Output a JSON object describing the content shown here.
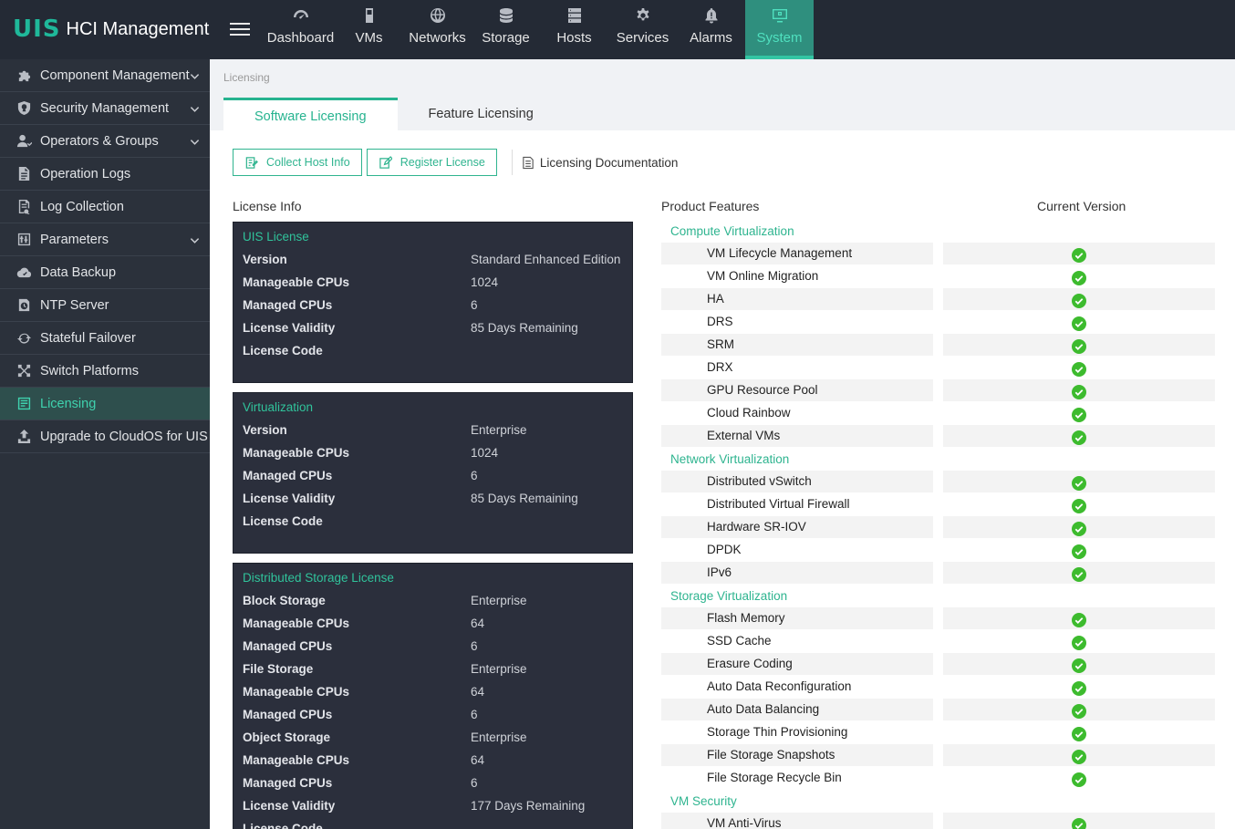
{
  "app": {
    "logo_mark": "UIS",
    "logo_text": "HCI Management"
  },
  "nav": [
    {
      "label": "Dashboard",
      "icon": "gauge-icon"
    },
    {
      "label": "VMs",
      "icon": "vm-icon"
    },
    {
      "label": "Networks",
      "icon": "globe-icon"
    },
    {
      "label": "Storage",
      "icon": "database-icon"
    },
    {
      "label": "Hosts",
      "icon": "server-icon"
    },
    {
      "label": "Services",
      "icon": "gear-icon"
    },
    {
      "label": "Alarms",
      "icon": "bell-icon"
    },
    {
      "label": "System",
      "icon": "monitor-icon",
      "active": true
    }
  ],
  "sidebar": [
    {
      "label": "Component Management",
      "icon": "puzzle-icon",
      "expandable": true
    },
    {
      "label": "Security Management",
      "icon": "shield-icon",
      "expandable": true
    },
    {
      "label": "Operators & Groups",
      "icon": "user-icon",
      "expandable": true
    },
    {
      "label": "Operation Logs",
      "icon": "file-icon"
    },
    {
      "label": "Log Collection",
      "icon": "log-icon"
    },
    {
      "label": "Parameters",
      "icon": "sliders-icon",
      "expandable": true
    },
    {
      "label": "Data Backup",
      "icon": "cloud-icon"
    },
    {
      "label": "NTP Server",
      "icon": "clock-icon"
    },
    {
      "label": "Stateful Failover",
      "icon": "failover-icon"
    },
    {
      "label": "Switch Platforms",
      "icon": "switch-icon"
    },
    {
      "label": "Licensing",
      "icon": "license-icon",
      "active": true
    },
    {
      "label": "Upgrade to CloudOS for UIS",
      "icon": "upgrade-icon"
    }
  ],
  "breadcrumb": "Licensing",
  "tabs": [
    {
      "label": "Software Licensing",
      "active": true
    },
    {
      "label": "Feature Licensing"
    }
  ],
  "toolbar": {
    "collect": "Collect Host Info",
    "register": "Register License",
    "doc": "Licensing Documentation"
  },
  "license_info_title": "License Info",
  "license_cards": [
    {
      "title": "UIS License",
      "rows": [
        {
          "k": "Version",
          "v": "Standard Enhanced Edition"
        },
        {
          "k": "Manageable CPUs",
          "v": "1024"
        },
        {
          "k": "Managed CPUs",
          "v": "6"
        },
        {
          "k": "License Validity",
          "v": "85 Days Remaining"
        },
        {
          "k": "License Code",
          "v": ""
        }
      ]
    },
    {
      "title": "Virtualization",
      "rows": [
        {
          "k": "Version",
          "v": "Enterprise"
        },
        {
          "k": "Manageable CPUs",
          "v": "1024"
        },
        {
          "k": "Managed CPUs",
          "v": "6"
        },
        {
          "k": "License Validity",
          "v": "85 Days Remaining"
        },
        {
          "k": "License Code",
          "v": ""
        }
      ]
    },
    {
      "title": "Distributed Storage License",
      "rows": [
        {
          "k": "Block Storage",
          "v": "Enterprise"
        },
        {
          "k": "Manageable CPUs",
          "v": "64"
        },
        {
          "k": "Managed CPUs",
          "v": "6"
        },
        {
          "k": "File Storage",
          "v": "Enterprise"
        },
        {
          "k": "Manageable CPUs",
          "v": "64"
        },
        {
          "k": "Managed CPUs",
          "v": "6"
        },
        {
          "k": "Object Storage",
          "v": "Enterprise"
        },
        {
          "k": "Manageable CPUs",
          "v": "64"
        },
        {
          "k": "Managed CPUs",
          "v": "6"
        },
        {
          "k": "License Validity",
          "v": "177 Days Remaining"
        },
        {
          "k": "License Code",
          "v": ""
        }
      ]
    }
  ],
  "features_header": {
    "product": "Product Features",
    "version": "Current Version"
  },
  "feature_groups": [
    {
      "title": "Compute Virtualization",
      "items": [
        "VM Lifecycle Management",
        "VM Online Migration",
        "HA",
        "DRS",
        "SRM",
        "DRX",
        "GPU Resource Pool",
        "Cloud Rainbow",
        "External VMs"
      ]
    },
    {
      "title": "Network Virtualization",
      "items": [
        "Distributed vSwitch",
        "Distributed Virtual Firewall",
        "Hardware SR-IOV",
        "DPDK",
        "IPv6"
      ]
    },
    {
      "title": "Storage Virtualization",
      "items": [
        "Flash Memory",
        "SSD Cache",
        "Erasure Coding",
        "Auto Data Reconfiguration",
        "Auto Data Balancing",
        "Storage Thin Provisioning",
        "File Storage Snapshots",
        "File Storage Recycle Bin"
      ]
    },
    {
      "title": "VM Security",
      "items": [
        "VM Anti-Virus"
      ]
    }
  ],
  "colors": {
    "accent": "#26b38f",
    "topbar": "#242a35",
    "sidebar": "#2b313b",
    "card": "#2b2f3c",
    "check": "#3dbb2e"
  }
}
